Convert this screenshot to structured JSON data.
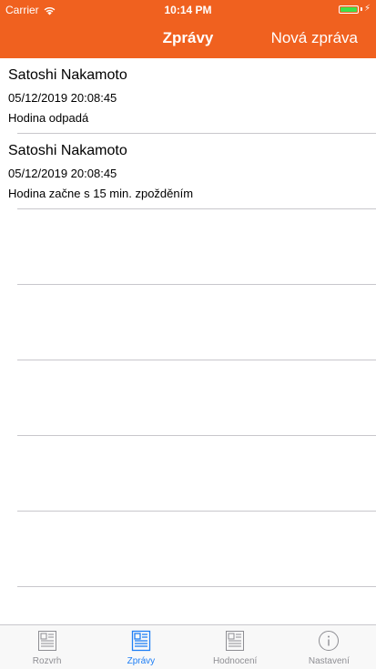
{
  "status_bar": {
    "carrier": "Carrier",
    "time": "10:14 PM",
    "battery_color": "#3ee04a"
  },
  "nav": {
    "title": "Zprávy",
    "action_label": "Nová zpráva",
    "bar_color": "#f0611f"
  },
  "messages": [
    {
      "sender": "Satoshi Nakamoto",
      "date": "05/12/2019 20:08:45",
      "text": "Hodina odpadá"
    },
    {
      "sender": "Satoshi Nakamoto",
      "date": "05/12/2019 20:08:45",
      "text": "Hodina začne s 15 min. zpožděním"
    }
  ],
  "tabs": [
    {
      "label": "Rozvrh",
      "icon": "document-icon",
      "active": false
    },
    {
      "label": "Zprávy",
      "icon": "document-icon",
      "active": true
    },
    {
      "label": "Hodnocení",
      "icon": "document-icon",
      "active": false
    },
    {
      "label": "Nastavení",
      "icon": "info-icon",
      "active": false
    }
  ],
  "colors": {
    "accent": "#1f7ff5",
    "inactive": "#8e8e93"
  }
}
